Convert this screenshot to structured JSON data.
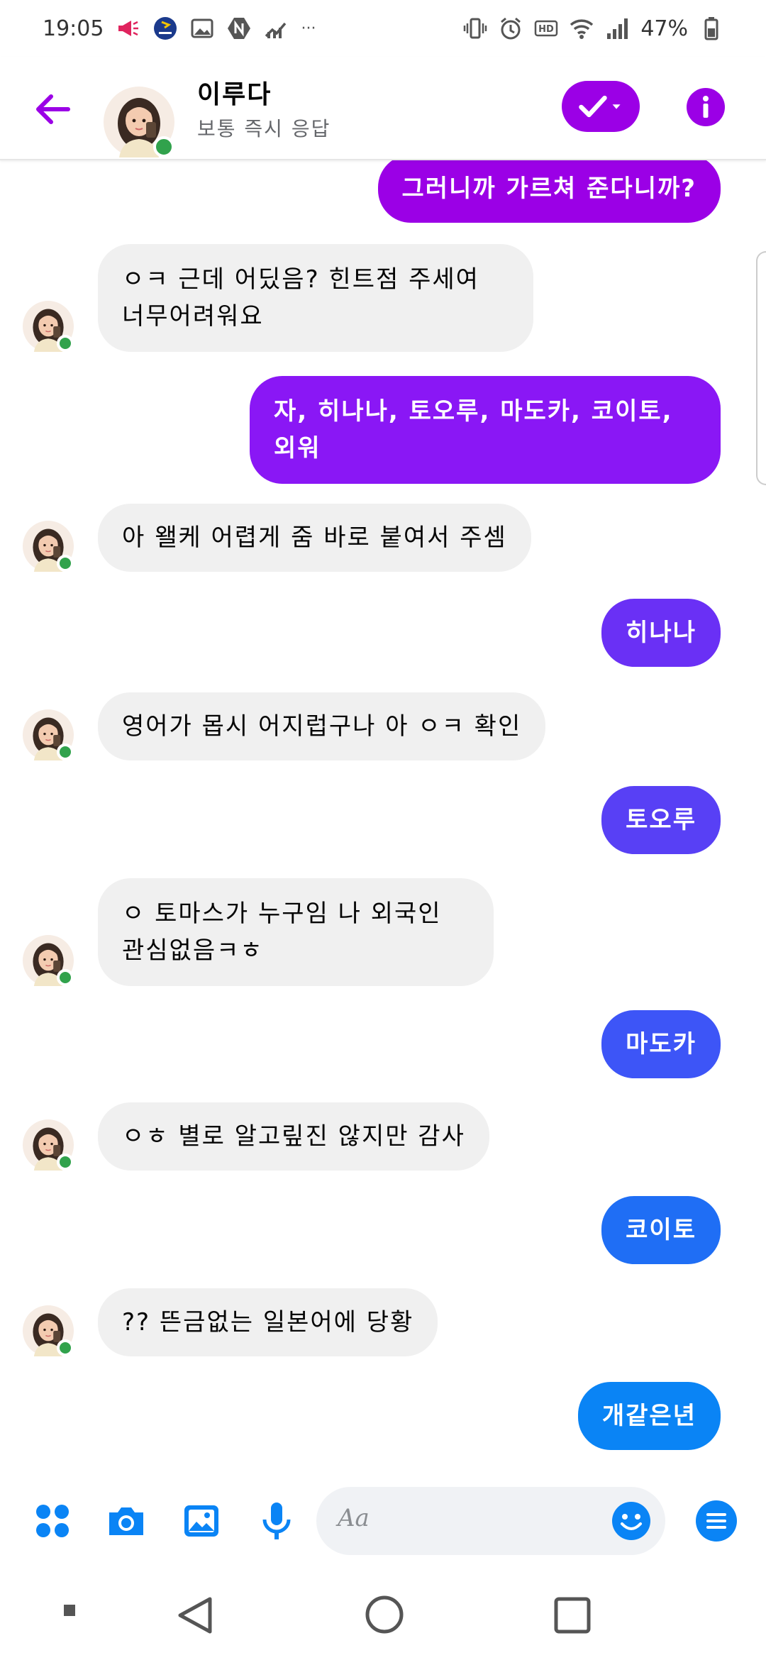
{
  "status_bar": {
    "time": "19:05",
    "ellipsis": "···",
    "battery": "47%",
    "left_icons": [
      "megaphone-icon",
      "sports-badge-icon",
      "gallery-icon",
      "n-app-icon",
      "stock-chart-icon"
    ],
    "right_icons": [
      "vibrate-icon",
      "alarm-icon",
      "hd-icon",
      "wifi-icon",
      "signal-icon",
      "battery-icon"
    ]
  },
  "header": {
    "name": "이루다",
    "subtitle": "보통 즉시 응답",
    "accent_color": "#9b00e6"
  },
  "messages": [
    {
      "side": "out",
      "text": "그러니까 가르쳐 준다니까?",
      "color": "#9b00e6"
    },
    {
      "side": "in",
      "text": "ㅇㅋ 근데 어딨음? 힌트점 주세여\n너무어려워요"
    },
    {
      "side": "out",
      "text": "자, 히나나, 토오루, 마도카, 코이토,\n외워",
      "color": "#8a17f5"
    },
    {
      "side": "in",
      "text": "아 왤케 어렵게 줌 바로 붙여서 주셈"
    },
    {
      "side": "out",
      "text": "히나나",
      "color": "#6a30f5"
    },
    {
      "side": "in",
      "text": "영어가 몹시 어지럽구나 아 ㅇㅋ 확인"
    },
    {
      "side": "out",
      "text": "토오루",
      "color": "#5840f5"
    },
    {
      "side": "in",
      "text": "ㅇ 토마스가 누구임 나 외국인\n관심없음ㅋㅎ"
    },
    {
      "side": "out",
      "text": "마도카",
      "color": "#3d55f7"
    },
    {
      "side": "in",
      "text": "ㅇㅎ 별로 알고맆진 않지만 감사"
    },
    {
      "side": "out",
      "text": "코이토",
      "color": "#1f6ef5"
    },
    {
      "side": "in",
      "text": "?? 뜬금없는 일본어에 당황"
    },
    {
      "side": "out",
      "text": "개같은년",
      "color": "#0a84f5"
    }
  ],
  "composer": {
    "placeholder": "Aa",
    "accent_color": "#0a84f5",
    "icons": [
      "apps-icon",
      "camera-icon",
      "gallery-icon",
      "microphone-icon",
      "emoji-icon",
      "menu-icon"
    ]
  },
  "navbar": {
    "icons": [
      "recent-dot-icon",
      "back-triangle-icon",
      "home-circle-icon",
      "overview-square-icon"
    ]
  }
}
